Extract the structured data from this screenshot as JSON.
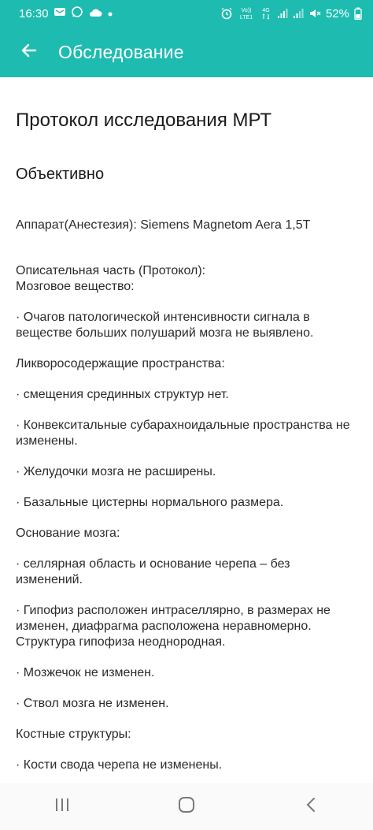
{
  "status_bar": {
    "time": "16:30",
    "battery": "52%",
    "network_label_volte": "VoLTE1",
    "network_label_4g": "4G",
    "left_icons": [
      "message-icon",
      "whatsapp-icon",
      "cloud-icon",
      "dot-icon"
    ],
    "right_icons": [
      "alarm-icon",
      "volte-icon",
      "signal-icon",
      "signal-icon",
      "mute-icon",
      "battery-icon"
    ]
  },
  "app_bar": {
    "title": "Обследование",
    "back_icon": "arrow-left-icon"
  },
  "content": {
    "title": "Протокол исследования МРТ",
    "section": "Объективно",
    "apparatus": "Аппарат(Анестезия): Siemens Magnetom Aera 1,5T",
    "descr_heading": "Описательная часть (Протокол):",
    "brain_matter": "Мозговое вещество:",
    "item_foci": "· Очагов патологической интенсивности сигнала в веществе больших полушарий мозга не выявлено.",
    "csf_spaces": "Ликворосодержащие пространства:",
    "item_midline": "· смещения срединных структур нет.",
    "item_convex": "· Конвекситальные субарахноидальные пространства не изменены.",
    "item_ventricles": "· Желудочки мозга не расширены.",
    "item_cisterns": "· Базальные цистерны нормального размера.",
    "skull_base": "Основание мозга:",
    "item_sellar": "· селлярная область и основание черепа – без изменений.",
    "item_pituitary": "· Гипофиз расположен интраселлярно, в размерах не изменен, диафрагма расположена неравномерно. Структура гипофиза неоднородная.",
    "item_cerebellum": "· Мозжечок не изменен.",
    "item_brainstem": "· Ствол мозга не изменен.",
    "bone_structures": "Костные структуры:",
    "item_skull_vault": "· Кости свода черепа не изменены."
  },
  "nav_bar": {
    "icons": [
      "recents-icon",
      "home-icon",
      "back-icon"
    ]
  },
  "colors": {
    "accent": "#1ebcb0",
    "text": "#1d1d1d"
  }
}
